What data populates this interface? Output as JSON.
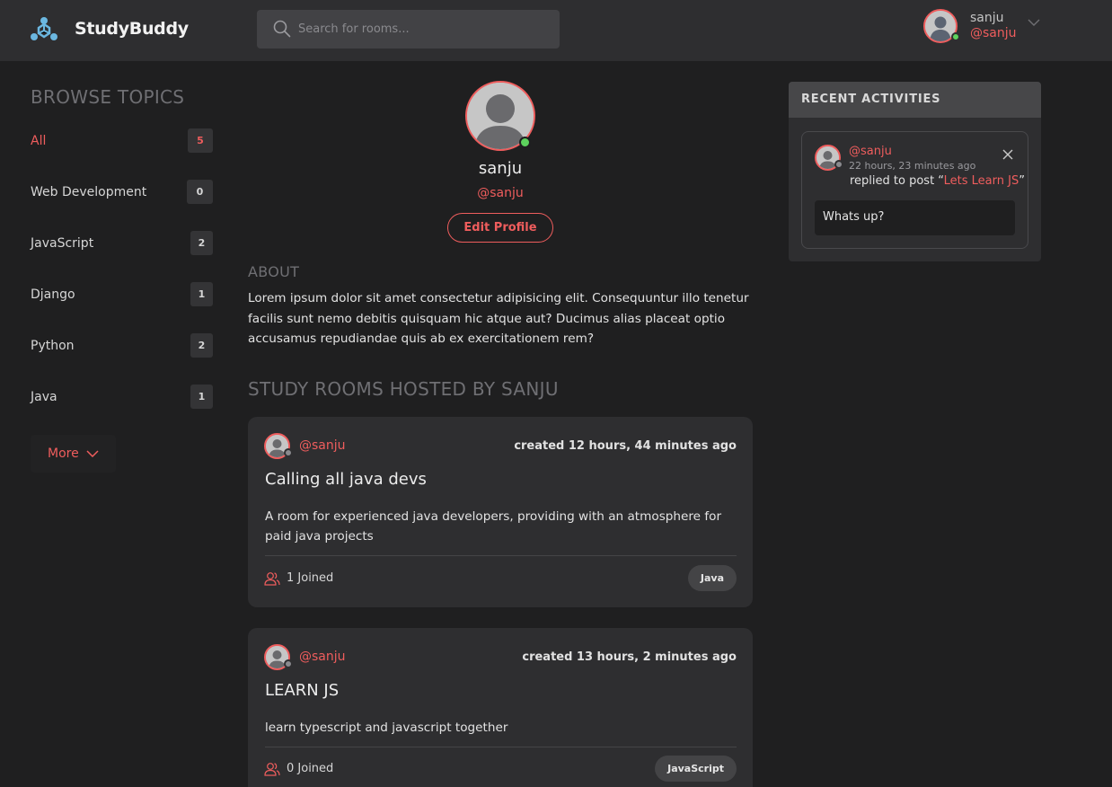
{
  "header": {
    "brand": "StudyBuddy",
    "search_placeholder": "Search for rooms...",
    "user": {
      "name": "sanju",
      "handle": "@sanju"
    }
  },
  "sidebar": {
    "title": "BROWSE TOPICS",
    "topics": [
      {
        "label": "All",
        "count": "5"
      },
      {
        "label": "Web Development",
        "count": "0"
      },
      {
        "label": "JavaScript",
        "count": "2"
      },
      {
        "label": "Django",
        "count": "1"
      },
      {
        "label": "Python",
        "count": "2"
      },
      {
        "label": "Java",
        "count": "1"
      }
    ],
    "more_label": "More"
  },
  "profile": {
    "name": "sanju",
    "handle": "@sanju",
    "edit_label": "Edit Profile",
    "about_title": "ABOUT",
    "about_text": "Lorem ipsum dolor sit amet consectetur adipisicing elit. Consequuntur illo tenetur facilis sunt nemo debitis quisquam hic atque aut? Ducimus alias placeat optio accusamus repudiandae quis ab ex exercitationem rem?",
    "rooms_title": "STUDY ROOMS HOSTED BY SANJU"
  },
  "rooms": [
    {
      "host": "@sanju",
      "created": "created 12 hours, 44 minutes ago",
      "title": "Calling all java devs",
      "description": "A room for experienced java developers, providing with an atmosphere for paid java projects",
      "joined": "1 Joined",
      "topic": "Java"
    },
    {
      "host": "@sanju",
      "created": "created 13 hours, 2 minutes ago",
      "title": "LEARN JS",
      "description": "learn typescript and javascript together",
      "joined": "0 Joined",
      "topic": "JavaScript"
    }
  ],
  "activities": {
    "title": "RECENT ACTIVITIES",
    "items": [
      {
        "handle": "@sanju",
        "time": "22 hours, 23 minutes ago",
        "action_prefix": "replied to post “",
        "post": "Lets Learn JS",
        "action_suffix": "”",
        "reply": "Whats up?"
      }
    ]
  },
  "colors": {
    "accent": "#ef5d5d",
    "background": "#1f1f20",
    "surface": "#2e2e30",
    "online": "#5dd25d",
    "offline": "#8a8a8e"
  }
}
